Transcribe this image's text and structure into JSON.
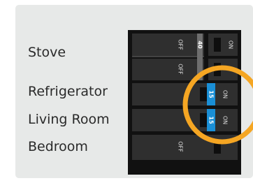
{
  "circuits": [
    {
      "name": "Stove"
    },
    {
      "name": "Refrigerator"
    },
    {
      "name": "Living Room"
    },
    {
      "name": "Bedroom"
    }
  ],
  "breakers": {
    "off_label": "OFF",
    "on_label": "ON",
    "stove_amps": "40",
    "refrigerator_amps": "15",
    "living_room_amps": "15"
  },
  "colors": {
    "background": "#e7e9e8",
    "breaker_body": "#2f2f2f",
    "active_handle": "#1a8fd6",
    "highlight_ring": "#f5a623"
  }
}
